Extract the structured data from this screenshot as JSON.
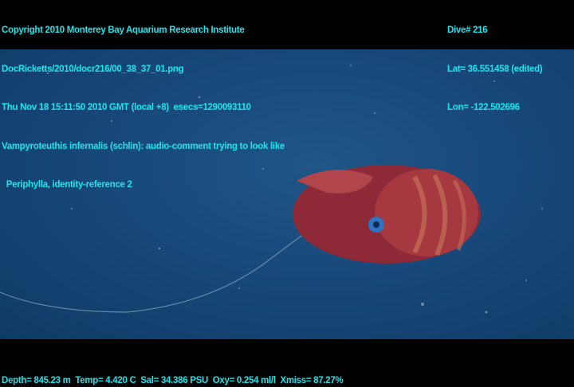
{
  "header_left": [
    "Copyright 2010 Monterey Bay Aquarium Research Institute",
    "DocRicketts/2010/docr216/00_38_37_01.png",
    "Thu Nov 18 15:11:50 2010 GMT (local +8)  esecs=1290093110",
    "Vampyroteuthis infernalis (schlin): audio-comment trying to look like",
    "  Periphylla, identity-reference 2"
  ],
  "header_right": [
    "Dive# 216",
    "Lat= 36.551458 (edited)",
    "Lon= -122.502696"
  ],
  "footer": "Depth= 845.23 m  Temp= 4.420 C  Sal= 34.386 PSU  Oxy= 0.254 ml/l  Xmiss= 87.27%",
  "colors": {
    "overlay_text": "#19e6ee",
    "water": "#17497a",
    "animal": "#9a2f3c"
  }
}
